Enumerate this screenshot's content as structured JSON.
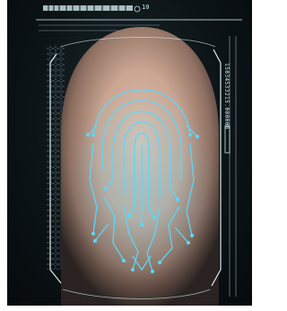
{
  "scan": {
    "id_text": "15034533215.000000",
    "readout": "10"
  },
  "colors": {
    "background": "#0b1214",
    "finger": "#c9a592",
    "circuit": "#59d9ff",
    "hud": "#cfe9ee"
  },
  "icons": [
    "fingerprint-circuit",
    "hud-frame",
    "barcode-strip"
  ]
}
